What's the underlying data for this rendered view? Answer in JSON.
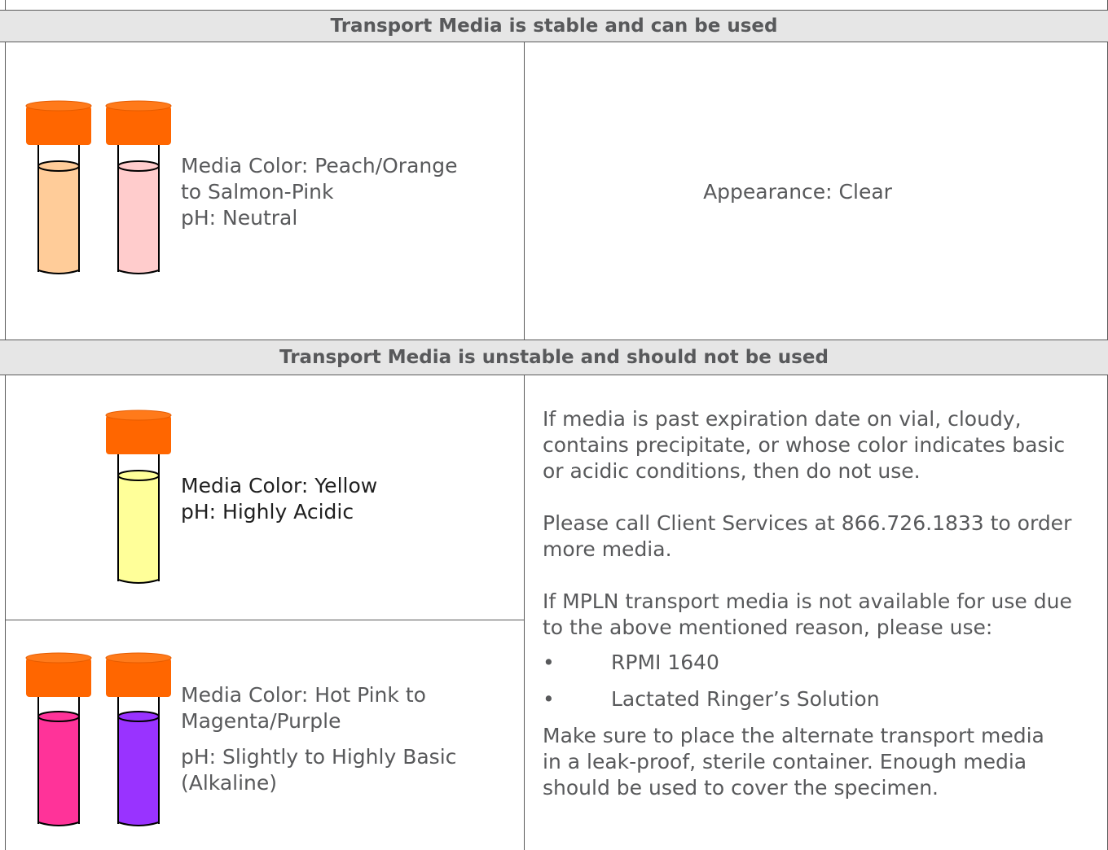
{
  "stable": {
    "header": "Transport Media is stable and can be used",
    "left": {
      "lines": [
        "Media Color: Peach/Orange",
        "to Salmon-Pink",
        "pH: Neutral"
      ],
      "vials": [
        {
          "fill": "#ffcc99"
        },
        {
          "fill": "#ffcccc"
        }
      ]
    },
    "right": {
      "appearance": "Appearance: Clear"
    }
  },
  "unstable": {
    "header": "Transport Media is unstable and should not be used",
    "acidic": {
      "lines": [
        "Media Color: Yellow",
        "pH: Highly Acidic"
      ],
      "vials": [
        {
          "fill": "#ffff99"
        }
      ]
    },
    "basic": {
      "lines": [
        "Media Color: Hot Pink to",
        "Magenta/Purple"
      ],
      "ph_lines": [
        "pH: Slightly to Highly Basic",
        "(Alkaline)"
      ],
      "vials": [
        {
          "fill": "#ff3399"
        },
        {
          "fill": "#9933ff"
        }
      ]
    },
    "instructions": {
      "p1": [
        "If media is past expiration date on vial, cloudy,",
        "contains precipitate, or whose color indicates basic",
        "or acidic conditions, then do not use."
      ],
      "p2": [
        "Please call Client Services at 866.726.1833 to order",
        "more media."
      ],
      "p3": [
        "If MPLN transport media is not available for use due",
        "to the above mentioned reason, please use:"
      ],
      "bullets": [
        "RPMI 1640",
        "Lactated Ringer’s Solution"
      ],
      "bullet_char": "•",
      "p4": [
        "Make sure to place the alternate transport media",
        "in a leak-proof, sterile container.  Enough media",
        "should be used to cover the specimen."
      ]
    }
  },
  "colors": {
    "cap": "#ff6600",
    "cap_dark": "#e65c00",
    "border": "#5a5a5a",
    "header_bg": "#e6e6e6",
    "text": "#58595b"
  }
}
